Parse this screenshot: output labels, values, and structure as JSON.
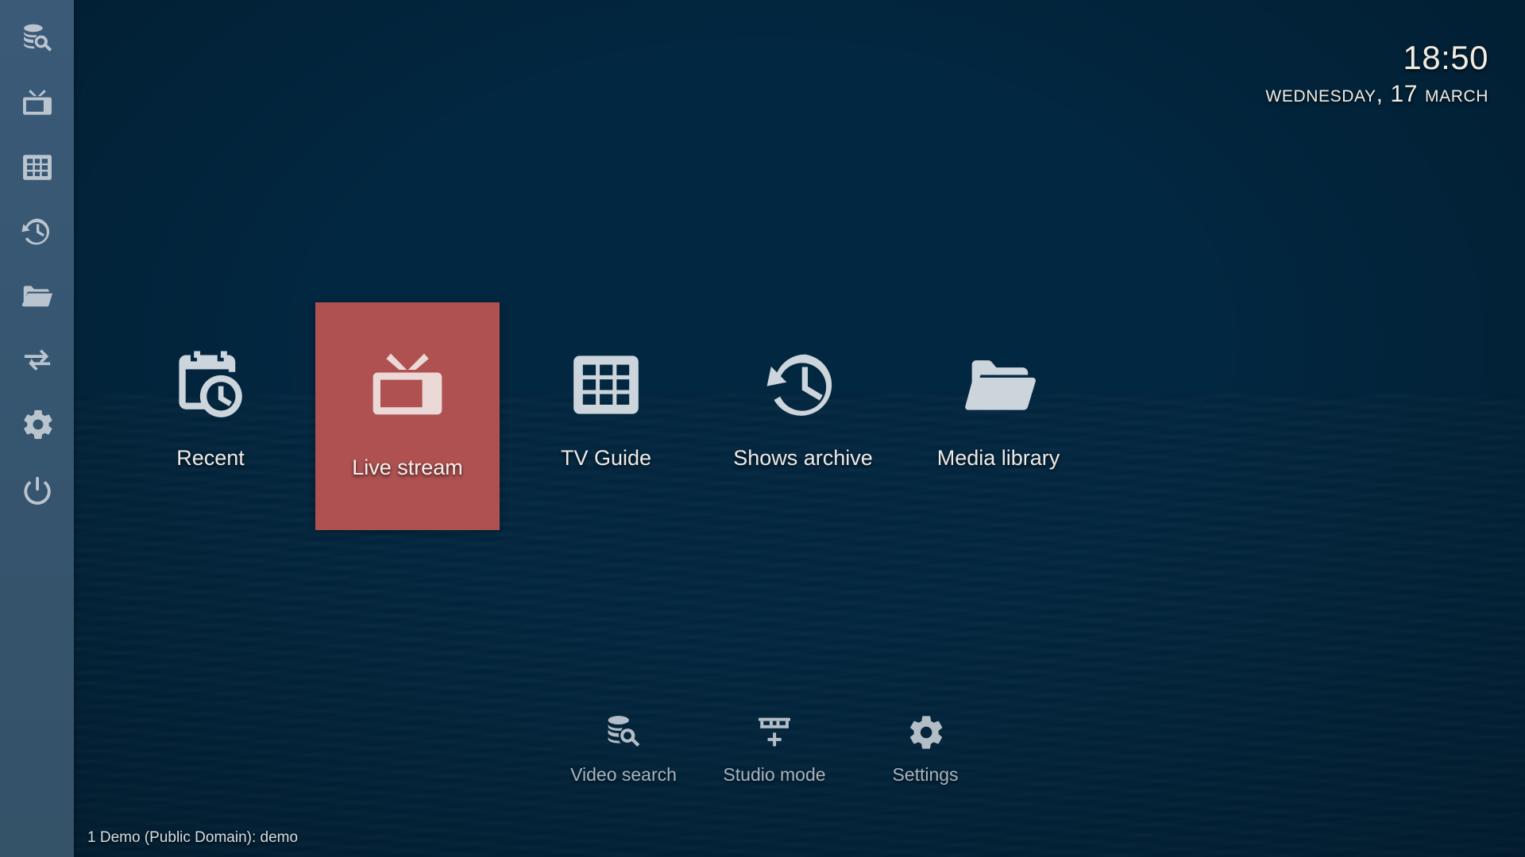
{
  "theme": {
    "sidebar_bg": "#37566f",
    "background_top": "#033253",
    "background_bottom": "#0b3c5b",
    "focus_color": "#b05151",
    "icon_color": "#ccd4dc",
    "text_color": "#eceaea"
  },
  "clock": {
    "time": "18:50",
    "date": "Wednesday, 17 March"
  },
  "sidebar": {
    "items": [
      {
        "label": "Video search",
        "icon": "database-search-icon"
      },
      {
        "label": "Live stream",
        "icon": "tv-icon"
      },
      {
        "label": "TV Guide",
        "icon": "grid-icon"
      },
      {
        "label": "Shows archive",
        "icon": "history-clock-icon"
      },
      {
        "label": "Media library",
        "icon": "folder-icon"
      },
      {
        "label": "Studio mode",
        "icon": "swap-arrows-icon"
      },
      {
        "label": "Settings",
        "icon": "gear-icon"
      },
      {
        "label": "Power",
        "icon": "power-icon"
      }
    ]
  },
  "main_menu": {
    "items": [
      {
        "label": "Recent",
        "icon": "calendar-clock-icon",
        "focused": false
      },
      {
        "label": "Live stream",
        "icon": "tv-icon",
        "focused": true
      },
      {
        "label": "TV Guide",
        "icon": "grid-icon",
        "focused": false
      },
      {
        "label": "Shows archive",
        "icon": "history-clock-icon",
        "focused": false
      },
      {
        "label": "Media library",
        "icon": "folder-icon",
        "focused": false
      }
    ]
  },
  "sub_menu": {
    "items": [
      {
        "label": "Video search",
        "icon": "database-search-icon"
      },
      {
        "label": "Studio mode",
        "icon": "grid-plus-icon"
      },
      {
        "label": "Settings",
        "icon": "gear-icon"
      }
    ]
  },
  "status": {
    "text": "1 Demo (Public Domain): demo"
  }
}
